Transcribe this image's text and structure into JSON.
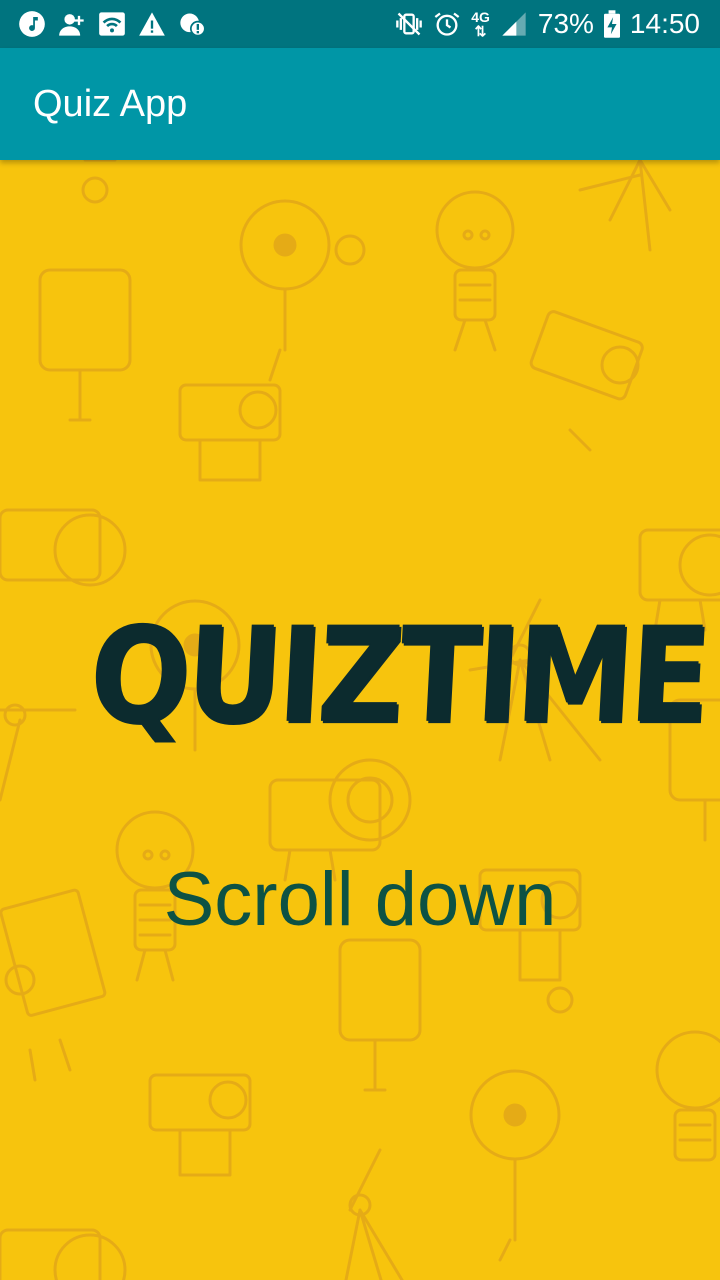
{
  "status_bar": {
    "icons_left": [
      "music-note-icon",
      "add-contact-icon",
      "wifi-box-icon",
      "warning-icon",
      "cloud-sync-icon"
    ],
    "icons_right": [
      "vibrate-mute-icon",
      "alarm-icon",
      "network-4g-icon",
      "signal-icon"
    ],
    "network_label": "4G",
    "battery_percent": "73%",
    "battery_icon": "battery-charging-icon",
    "time": "14:50"
  },
  "app_bar": {
    "title": "Quiz App"
  },
  "main": {
    "logo_text": "QUIZTIME!",
    "instruction": "Scroll down",
    "background_color": "#f7c40d",
    "logo_color": "#0c2b2e",
    "instruction_color": "#0d5244"
  }
}
